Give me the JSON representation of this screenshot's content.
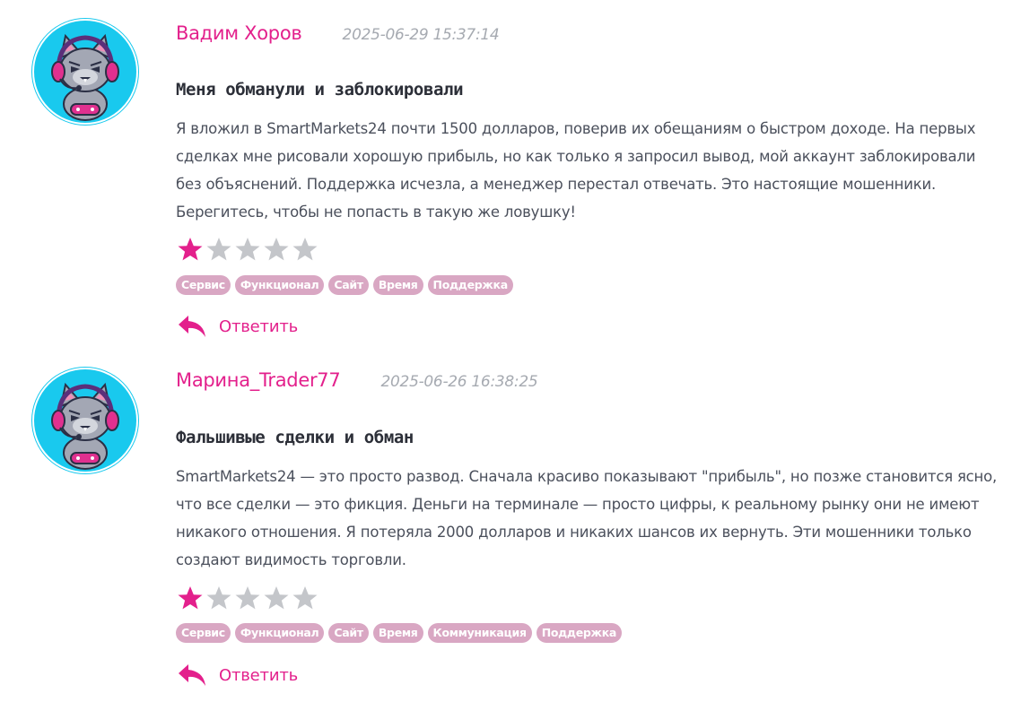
{
  "reviews": [
    {
      "author": "Вадим Хоров",
      "date": "2025-06-29 15:37:14",
      "title": "Меня обманули и заблокировали",
      "text": "Я вложил в SmartMarkets24 почти 1500 долларов, поверив их обещаниям о быстром доходе. На первых сделках мне рисовали хорошую прибыль, но как только я запросил вывод, мой аккаунт заблокировали без объяснений. Поддержка исчезла, а менеджер перестал отвечать. Это настоящие мошенники. Берегитесь, чтобы не попасть в такую же ловушку!",
      "rating": 1,
      "rating_max": 5,
      "tags": [
        "Сервис",
        "Функционал",
        "Сайт",
        "Время",
        "Поддержка"
      ],
      "reply_label": "Ответить"
    },
    {
      "author": "Марина_Trader77",
      "date": "2025-06-26 16:38:25",
      "title": "Фальшивые сделки и обман",
      "text": "SmartMarkets24 — это просто развод. Сначала красиво показывают \"прибыль\", но позже становится ясно, что все сделки — это фикция. Деньги на терминале — просто цифры, к реальному рынку они не имеют никакого отношения. Я потеряла 2000 долларов и никаких шансов их вернуть. Эти мошенники только создают видимость торговли.",
      "rating": 1,
      "rating_max": 5,
      "tags": [
        "Сервис",
        "Функционал",
        "Сайт",
        "Время",
        "Коммуникация",
        "Поддержка"
      ],
      "reply_label": "Ответить"
    }
  ],
  "colors": {
    "accent": "#e3208c",
    "star_filled": "#e3208c",
    "star_empty": "#c4c6ca",
    "tag_bg": "#d9a7c3",
    "avatar_bg": "#19c9ee"
  },
  "icons": {
    "avatar": "gamer-cat-avatar",
    "star": "star-icon",
    "reply": "reply-arrow-icon"
  }
}
